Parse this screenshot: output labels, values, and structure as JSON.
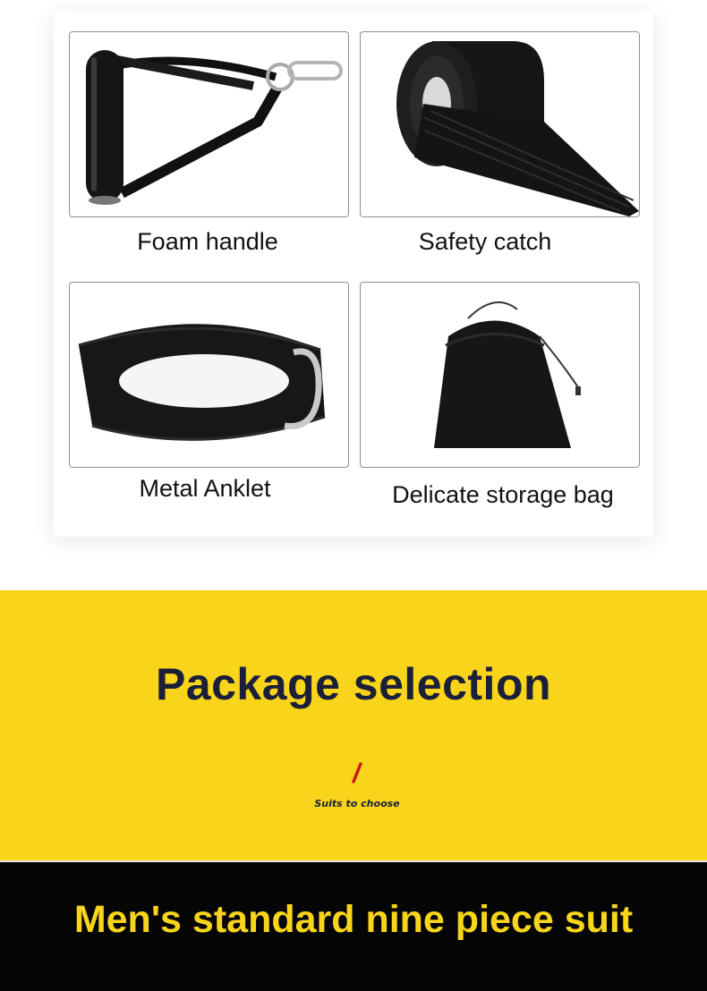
{
  "products": [
    {
      "caption": "Foam handle",
      "icon": "foam-handle-image"
    },
    {
      "caption": "Safety catch",
      "icon": "safety-catch-image"
    },
    {
      "caption": "Metal Anklet",
      "icon": "metal-anklet-image"
    },
    {
      "caption": "Delicate storage bag",
      "icon": "storage-bag-image"
    }
  ],
  "package": {
    "title": "Package selection",
    "subtitle": "Suits to choose"
  },
  "suit": {
    "title": "Men's standard nine piece suit"
  },
  "colors": {
    "yellow": "#f8d51a",
    "navy": "#1b1f3a",
    "black": "#050505",
    "slash": "#cc1a1a"
  }
}
